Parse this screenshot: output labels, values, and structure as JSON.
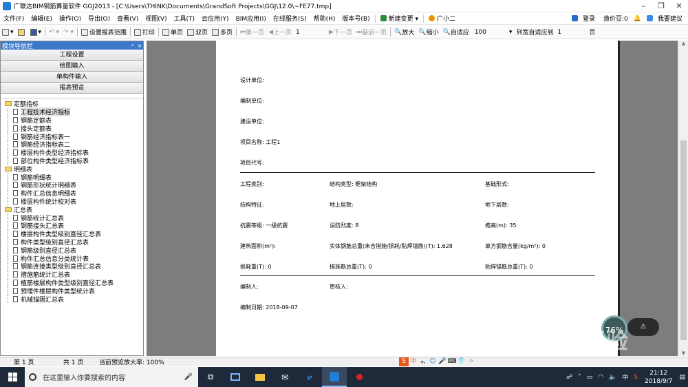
{
  "window": {
    "title": "广联达BIM钢筋算量软件 GGJ2013 - [C:\\Users\\THINK\\Documents\\GrandSoft Projects\\GGJ\\12.0\\~FE77.tmp]",
    "controls": [
      "–",
      "❐",
      "✕"
    ]
  },
  "menu": {
    "items": [
      "文件(F)",
      "编辑(E)",
      "操作(O)",
      "导出(O)",
      "查看(V)",
      "视图(V)",
      "工具(T)",
      "云应用(Y)",
      "BIM应用(I)",
      "在线服务(S)",
      "帮助(H)",
      "版本号(B)"
    ],
    "new_change": "新建变更",
    "assistant": "广小二",
    "login": "登录",
    "cost_beans": "造价豆:0",
    "feedback": "我要建议"
  },
  "toolbar": {
    "settings": "设置报表范围",
    "print": "打印",
    "single": "单页",
    "double": "双页",
    "multi": "多页",
    "first": "第一页",
    "prev": "上一页",
    "page_num": "1",
    "next": "下一页",
    "last": "最后一页",
    "zoom_in": "放大",
    "zoom_out": "缩小",
    "fit": "自适应",
    "zoom_val": "100",
    "col_fit": "列宽自适应到",
    "col_page": "1",
    "page_suffix": "页"
  },
  "panel": {
    "title": "模块导航栏",
    "pin": "ᵖ",
    "close": "×",
    "buttons": [
      "工程设置",
      "绘图输入",
      "单构件输入",
      "报表预览"
    ],
    "groups": [
      {
        "label": "定额指标",
        "items": [
          "工程技术经济指标",
          "钢筋定额表",
          "接头定额表",
          "钢筋经济指标表一",
          "钢筋经济指标表二",
          "楼层构件类型经济指标表",
          "部位构件类型经济指标表"
        ]
      },
      {
        "label": "明细表",
        "items": [
          "钢筋明细表",
          "钢筋形状统计明细表",
          "构件汇总信息明细表",
          "楼层构件统计校对表"
        ]
      },
      {
        "label": "汇总表",
        "items": [
          "钢筋统计汇总表",
          "钢筋接头汇总表",
          "楼层构件类型级别直径汇总表",
          "构件类型级别直径汇总表",
          "钢筋级别直径汇总表",
          "构件汇总信息分类统计表",
          "钢筋连接类型级别直径汇总表",
          "措施筋统计汇总表",
          "植筋楼层构件类型级别直径汇总表",
          "预埋件楼层构件类型统计表",
          "机械锚固汇总表"
        ]
      }
    ]
  },
  "report": {
    "design_unit": "设计单位:",
    "compile_unit": "编制单位:",
    "build_unit": "建设单位:",
    "project_name": "项目名称: 工程1",
    "project_code": "项目代号:",
    "category": "工程类别:",
    "structure_type": "结构类型: 框架结构",
    "foundation": "基础形式:",
    "structure_feature": "结构特征:",
    "above_floors": "地上层数:",
    "below_floors": "地下层数:",
    "seismic_grade": "抗震等级: 一级抗震",
    "fortification": "设防烈度: 8",
    "eave_height": "檐高(m): 35",
    "area": "建筑面积(m²):",
    "total_steel": "实体钢筋总重(未含措施/损耗/贴焊锚筋)(T): 1.628",
    "unit_steel": "单方钢筋含量(kg/m²): 0",
    "loss_weight": "损耗重(T): 0",
    "measure_total": "措施筋总重(T): 0",
    "weld_total": "贴焊锚筋总重(T): 0",
    "compiler": "编制人:",
    "reviewer": "审核人:",
    "compile_date": "编制日期: 2018-09-07"
  },
  "status": {
    "page": "第 1 页",
    "total": "共 1 页",
    "zoom": "当前预览放大率: 100%"
  },
  "ime": [
    "S",
    "中",
    "⁎,",
    "☺",
    "🎤",
    "⌨",
    "👕",
    "⁘"
  ],
  "overlay": {
    "perf": "76%",
    "net": "⚠",
    "watermark": "Bai⊙经验",
    "watermark_url": "jingyan.baidu.com"
  },
  "taskbar": {
    "search_placeholder": "在这里输入你要搜索的内容",
    "time": "21:12",
    "date": "2018/9/7"
  }
}
